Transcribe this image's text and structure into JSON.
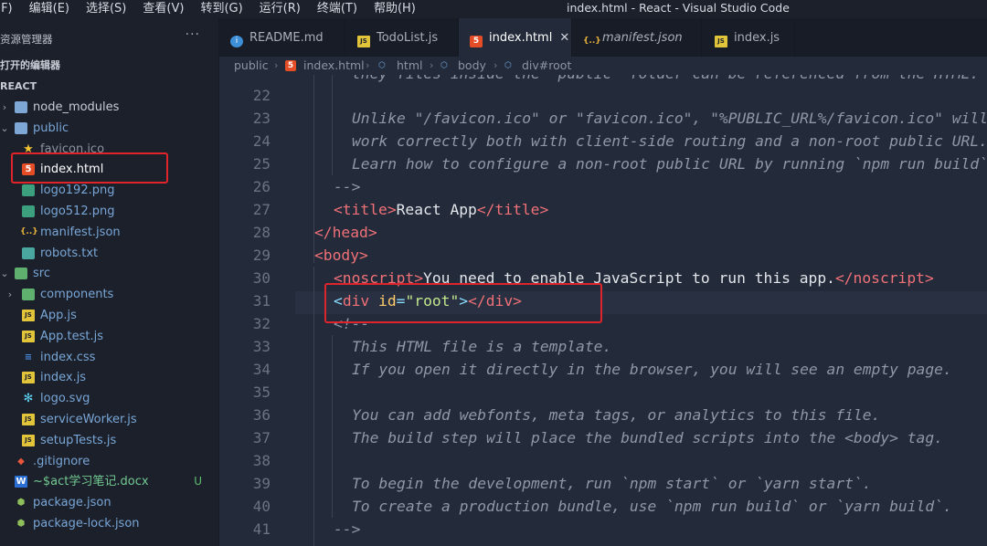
{
  "window": {
    "menu": [
      "(F)",
      "编辑(E)",
      "选择(S)",
      "查看(V)",
      "转到(G)",
      "运行(R)",
      "终端(T)",
      "帮助(H)"
    ],
    "title": "index.html - React - Visual Studio Code"
  },
  "sidebar": {
    "explorer_title": "资源管理器",
    "more": "···",
    "open_editors": "打开的编辑器",
    "project": "REACT",
    "items": [
      {
        "label": "node_modules",
        "icon": "folder-icon",
        "badge": ""
      },
      {
        "label": "public",
        "icon": "folder-icon",
        "badge": ""
      },
      {
        "label": "favicon.ico",
        "icon": "star-icon",
        "badge": ""
      },
      {
        "label": "index.html",
        "icon": "html5-icon",
        "badge": ""
      },
      {
        "label": "logo192.png",
        "icon": "image-icon",
        "badge": ""
      },
      {
        "label": "logo512.png",
        "icon": "image-icon",
        "badge": ""
      },
      {
        "label": "manifest.json",
        "icon": "json-icon",
        "badge": ""
      },
      {
        "label": "robots.txt",
        "icon": "text-file-icon",
        "badge": ""
      },
      {
        "label": "src",
        "icon": "folder-icon",
        "badge": ""
      },
      {
        "label": "components",
        "icon": "folder-icon",
        "badge": ""
      },
      {
        "label": "App.js",
        "icon": "js-icon",
        "badge": ""
      },
      {
        "label": "App.test.js",
        "icon": "js-icon",
        "badge": ""
      },
      {
        "label": "index.css",
        "icon": "css-icon",
        "badge": ""
      },
      {
        "label": "index.js",
        "icon": "js-icon",
        "badge": ""
      },
      {
        "label": "logo.svg",
        "icon": "react-icon",
        "badge": ""
      },
      {
        "label": "serviceWorker.js",
        "icon": "js-icon",
        "badge": ""
      },
      {
        "label": "setupTests.js",
        "icon": "js-icon",
        "badge": ""
      },
      {
        "label": ".gitignore",
        "icon": "git-icon",
        "badge": ""
      },
      {
        "label": "~$act学习笔记.docx",
        "icon": "word-icon",
        "badge": "U"
      },
      {
        "label": "package.json",
        "icon": "npm-icon",
        "badge": ""
      },
      {
        "label": "package-lock.json",
        "icon": "npm-icon",
        "badge": ""
      }
    ]
  },
  "tabs": [
    {
      "label": "README.md",
      "icon": "info-icon"
    },
    {
      "label": "TodoList.js",
      "icon": "js-icon"
    },
    {
      "label": "index.html",
      "icon": "html5-icon",
      "close": "✕"
    },
    {
      "label": "manifest.json",
      "icon": "json-icon"
    },
    {
      "label": "index.js",
      "icon": "js-icon"
    }
  ],
  "breadcrumb": [
    "public",
    "index.html",
    "html",
    "body",
    "div#root"
  ],
  "editor": {
    "line_numbers": [
      "22",
      "23",
      "24",
      "25",
      "26",
      "27",
      "28",
      "29",
      "30",
      "31",
      "32",
      "33",
      "34",
      "35",
      "36",
      "37",
      "38",
      "39",
      "40",
      "41"
    ],
    "lines": {
      "l21": "they files inside the `public` folder can be referenced from the HTML.",
      "l23": "Unlike \"/favicon.ico\" or \"favicon.ico\", \"%PUBLIC_URL%/favicon.ico\" will",
      "l24": "work correctly both with client-side routing and a non-root public URL.",
      "l25": "Learn how to configure a non-root public URL by running `npm run build`.",
      "l26": "-->",
      "l27_open": "<title>",
      "l27_text": "React App",
      "l27_close": "</title>",
      "l28": "</head>",
      "l29": "<body>",
      "l30_open": "<noscript>",
      "l30_text": "You need to enable JavaScript to run this app.",
      "l30_close": "</noscript>",
      "l31_lt": "<",
      "l31_tag": "div",
      "l31_attr": "id",
      "l31_eq": "=",
      "l31_val": "\"root\"",
      "l31_gt": ">",
      "l31_close": "</div>",
      "l32": "<!--",
      "l33": "This HTML file is a template.",
      "l34": "If you open it directly in the browser, you will see an empty page.",
      "l36": "You can add webfonts, meta tags, or analytics to this file.",
      "l37": "The build step will place the bundled scripts into the <body> tag.",
      "l39": "To begin the development, run `npm start` or `yarn start`.",
      "l40": "To create a production bundle, use `npm run build` or `yarn build`.",
      "l41": "-->"
    }
  }
}
